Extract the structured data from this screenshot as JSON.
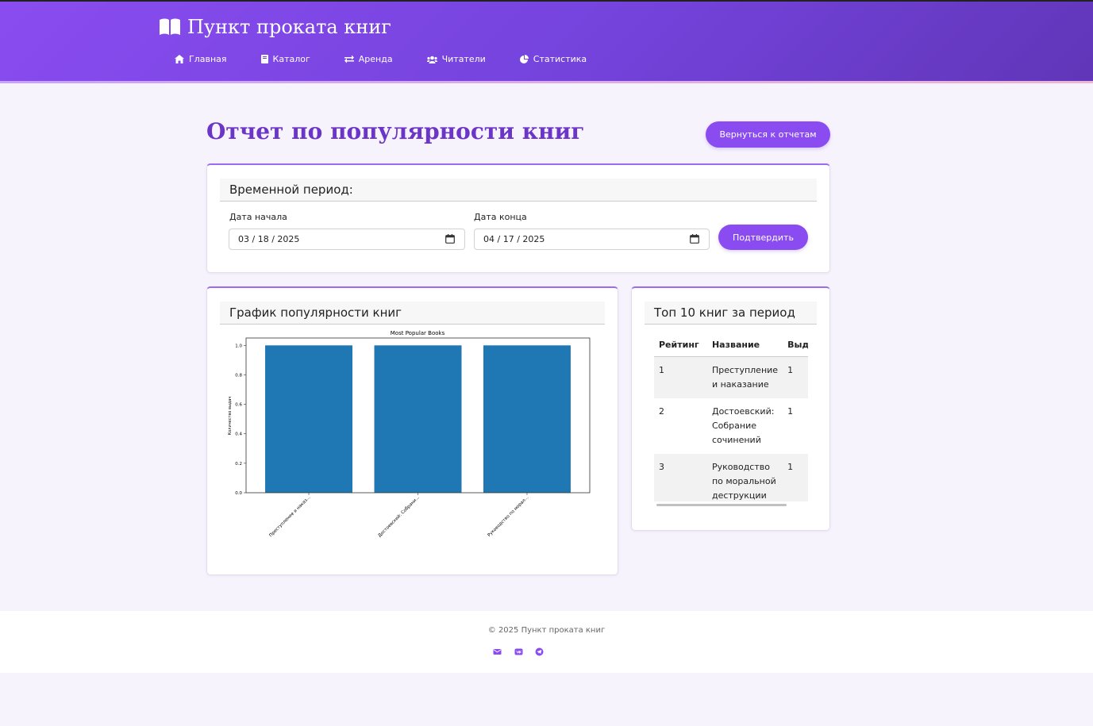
{
  "header": {
    "brand": "Пункт проката книг",
    "nav": [
      {
        "label": "Главная",
        "icon": "home-icon"
      },
      {
        "label": "Каталог",
        "icon": "book-icon"
      },
      {
        "label": "Аренда",
        "icon": "exchange-icon"
      },
      {
        "label": "Читатели",
        "icon": "users-icon"
      },
      {
        "label": "Статистика",
        "icon": "pie-chart-icon"
      }
    ]
  },
  "page": {
    "title": "Отчет по популярности книг",
    "back_button": "Вернуться к отчетам"
  },
  "period": {
    "header": "Временной период:",
    "start_label": "Дата начала",
    "start_value": "03 / 18 / 2025",
    "end_label": "Дата конца",
    "end_value": "04 / 17 / 2025",
    "confirm_button": "Подтвердить"
  },
  "chart_card": {
    "header": "График популярности книг"
  },
  "chart_data": {
    "type": "bar",
    "title": "Most Popular Books",
    "xlabel": "",
    "ylabel": "Количество выдач",
    "categories": [
      "Преступление и наказ...",
      "Достоевский: Собрани...",
      "Руководство по морал..."
    ],
    "values": [
      1,
      1,
      1
    ],
    "ylim": [
      0,
      1.05
    ],
    "yticks": [
      "0.0",
      "0.2",
      "0.4",
      "0.6",
      "0.8",
      "1.0"
    ],
    "bar_color": "#1f77b4"
  },
  "top_card": {
    "header": "Топ 10 книг за период",
    "columns": [
      "Рейтинг",
      "Название",
      "Выдач"
    ],
    "rows": [
      {
        "rank": "1",
        "title": "Преступление и наказание",
        "count": "1"
      },
      {
        "rank": "2",
        "title": "Достоевский: Собрание сочинений",
        "count": "1"
      },
      {
        "rank": "3",
        "title": "Руководство по моральной деструкции",
        "count": "1"
      }
    ]
  },
  "footer": {
    "copyright": "© 2025 Пункт проката книг",
    "social": [
      "envelope-icon",
      "vk-icon",
      "telegram-icon"
    ]
  },
  "colors": {
    "accent": "#8a4cf0",
    "title": "#6b36c8",
    "background": "#f7f3fd"
  }
}
